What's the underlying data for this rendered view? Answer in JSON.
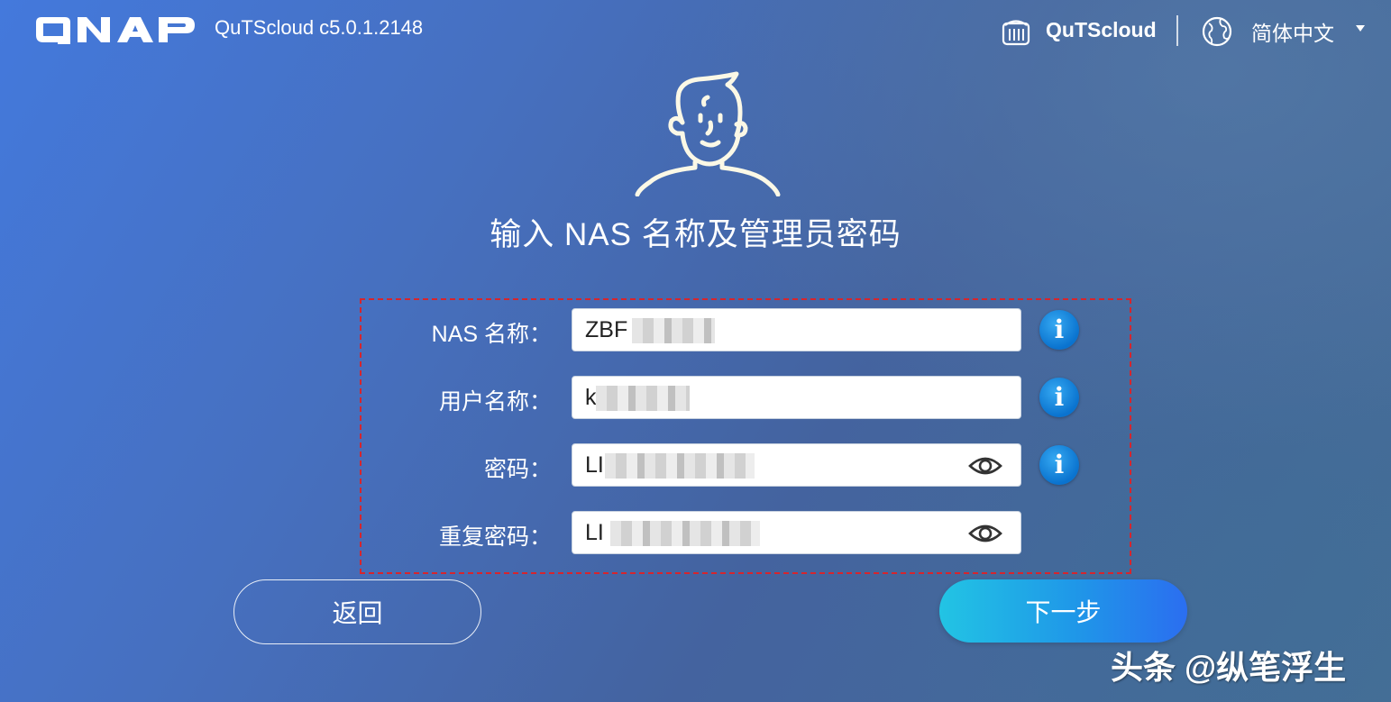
{
  "header": {
    "logo_text": "QNAP",
    "version": "QuTScloud c5.0.1.2148",
    "brand": "QuTScloud",
    "language": "简体中文"
  },
  "main": {
    "title": "输入 NAS 名称及管理员密码",
    "fields": [
      {
        "label": "NAS 名称：",
        "value": "ZBF",
        "has_info": true,
        "has_eye": false
      },
      {
        "label": "用户名称：",
        "value": "k",
        "has_info": true,
        "has_eye": false
      },
      {
        "label": "密码：",
        "value": "LI",
        "has_info": true,
        "has_eye": true
      },
      {
        "label": "重复密码：",
        "value": "LI",
        "has_info": false,
        "has_eye": true
      }
    ]
  },
  "buttons": {
    "back": "返回",
    "next": "下一步"
  },
  "watermark": "头条 @纵笔浮生",
  "colors": {
    "accent_start": "#22c4e4",
    "accent_end": "#2b6ef0",
    "highlight_border": "#d6252d",
    "info_icon": "#0a73cf"
  },
  "icons": [
    "qnap-logo",
    "cloud-server-icon",
    "globe-icon",
    "user-illustration",
    "info-icon",
    "eye-icon"
  ]
}
